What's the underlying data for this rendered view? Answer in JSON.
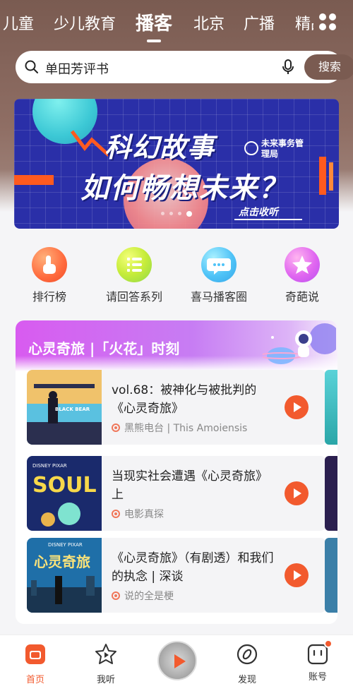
{
  "tabs": [
    {
      "label": "儿童"
    },
    {
      "label": "少儿教育"
    },
    {
      "label": "播客",
      "active": true
    },
    {
      "label": "北京"
    },
    {
      "label": "广播"
    },
    {
      "label": "精品"
    }
  ],
  "search": {
    "value": "单田芳评书",
    "button": "搜索"
  },
  "banner": {
    "title_line1": "科幻故事",
    "title_line2": "如何畅想未来？",
    "brand": "未来事务管理局",
    "cta": "点击收听",
    "slide_count": 4,
    "active_slide": 4
  },
  "quick_entries": [
    {
      "label": "排行榜",
      "icon": "hand-pointer-icon"
    },
    {
      "label": "请回答系列",
      "icon": "list-icon"
    },
    {
      "label": "喜马播客圈",
      "icon": "chat-bubble-icon"
    },
    {
      "label": "奇葩说",
      "icon": "star-icon"
    }
  ],
  "card": {
    "title": "心灵奇旅 |「火花」时刻",
    "episodes": [
      {
        "title": "vol.68：被神化与被批判的《心灵奇旅》",
        "source": "黑熊电台 | This Amoiensis",
        "cover_text": "BLACK BEAR"
      },
      {
        "title": "当现实社会遭遇《心灵奇旅》上",
        "source": "电影真探",
        "cover_text": "SOUL",
        "cover_brand": "DISNEY PIXAR"
      },
      {
        "title": "《心灵奇旅》（有剧透）和我们的执念 | 深谈",
        "source": "说的全是梗",
        "cover_text": "心灵奇旅",
        "cover_brand": "DISNEY PIXAR"
      }
    ]
  },
  "bottom_nav": [
    {
      "label": "首页",
      "icon": "home-icon",
      "active": true
    },
    {
      "label": "我听",
      "icon": "star-play-icon"
    },
    {
      "label": "",
      "icon": "player-disc-icon"
    },
    {
      "label": "发现",
      "icon": "compass-icon"
    },
    {
      "label": "账号",
      "icon": "account-icon",
      "badge": true
    }
  ]
}
